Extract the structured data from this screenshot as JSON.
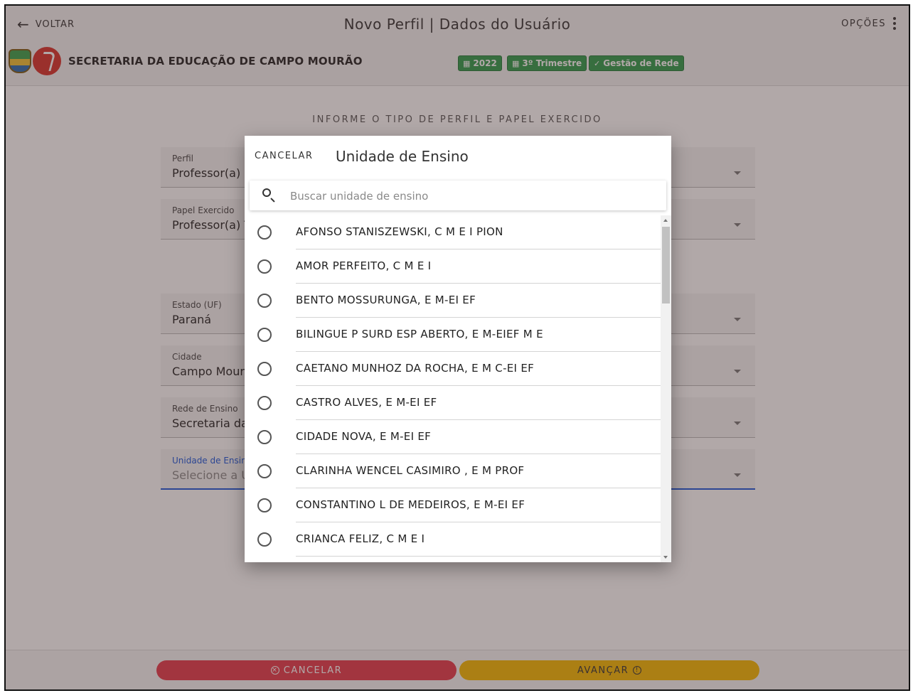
{
  "header": {
    "back_label": "VOLTAR",
    "title": "Novo Perfil | Dados do Usuário",
    "options_label": "OPÇÕES",
    "org_name": "SECRETARIA DA EDUCAÇÃO DE CAMPO MOURÃO",
    "badges": [
      "2022",
      "3º Trimestre",
      "Gestão de Rede"
    ],
    "badge_color": "#2e9b4b"
  },
  "form": {
    "section_title": "INFORME O TIPO DE PERFIL E PAPEL EXERCIDO",
    "fields": [
      {
        "label": "Perfil",
        "value": "Professor(a)"
      },
      {
        "label": "Papel Exercido",
        "value": "Professor(a) T"
      },
      {
        "label": "Estado (UF)",
        "value": "Paraná"
      },
      {
        "label": "Cidade",
        "value": "Campo Mourão"
      },
      {
        "label": "Rede de Ensino",
        "value": "Secretaria da"
      },
      {
        "label": "Unidade de Ensino",
        "value": "Selecione a U"
      }
    ]
  },
  "footer": {
    "cancel_label": "CANCELAR",
    "next_label": "AVANÇAR",
    "cancel_color": "#e63a4a",
    "next_color": "#f5b800"
  },
  "dialog": {
    "cancel_label": "CANCELAR",
    "title": "Unidade de Ensino",
    "search_placeholder": "Buscar unidade de ensino",
    "items": [
      "AFONSO STANISZEWSKI, C M E I PION",
      "AMOR PERFEITO, C M E I",
      "BENTO MOSSURUNGA, E M-EI EF",
      "BILINGUE P SURD ESP ABERTO, E M-EIEF M E",
      "CAETANO MUNHOZ DA ROCHA, E M C-EI EF",
      "CASTRO ALVES, E M-EI EF",
      "CIDADE NOVA, E M-EI EF",
      "CLARINHA WENCEL CASIMIRO , E M PROF",
      "CONSTANTINO L DE MEDEIROS, E M-EI EF",
      "CRIANCA FELIZ, C M E I"
    ]
  }
}
